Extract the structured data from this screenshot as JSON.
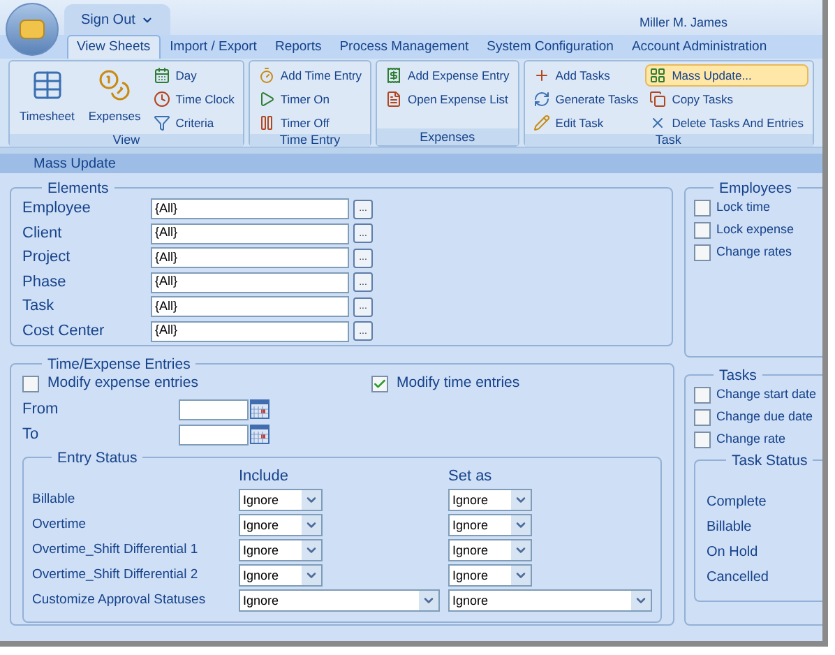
{
  "user_menu": {
    "label": "Sign Out"
  },
  "user_name": "Miller M. James",
  "tabs": [
    {
      "label": "View Sheets",
      "selected": true
    },
    {
      "label": "Import / Export",
      "selected": false
    },
    {
      "label": "Reports",
      "selected": false
    },
    {
      "label": "Process Management",
      "selected": false
    },
    {
      "label": "System Configuration",
      "selected": false
    },
    {
      "label": "Account Administration",
      "selected": false
    }
  ],
  "ribbon_groups": [
    {
      "label": "View",
      "items": [
        {
          "label": "Timesheet",
          "kind": "large",
          "selected": false
        },
        {
          "label": "Expenses",
          "kind": "large",
          "selected": false
        },
        {
          "label": "Day",
          "kind": "small",
          "selected": false
        },
        {
          "label": "Time Clock",
          "kind": "small",
          "selected": false
        },
        {
          "label": "Criteria",
          "kind": "small",
          "selected": false
        }
      ]
    },
    {
      "label": "Time Entry",
      "items": [
        {
          "label": "Add Time Entry",
          "kind": "small",
          "selected": false
        },
        {
          "label": "Timer On",
          "kind": "small",
          "selected": false
        },
        {
          "label": "Timer Off",
          "kind": "small",
          "selected": false
        }
      ]
    },
    {
      "label": "Expenses",
      "items": [
        {
          "label": "Add Expense Entry",
          "kind": "small",
          "selected": false
        },
        {
          "label": "Open Expense List",
          "kind": "small",
          "selected": false
        }
      ]
    },
    {
      "label": "Task",
      "items": [
        {
          "label": "Add Tasks",
          "kind": "small",
          "selected": false
        },
        {
          "label": "Generate Tasks",
          "kind": "small",
          "selected": false
        },
        {
          "label": "Edit Task",
          "kind": "small",
          "selected": false
        },
        {
          "label": "Mass Update...",
          "kind": "small",
          "selected": true
        },
        {
          "label": "Copy Tasks",
          "kind": "small",
          "selected": false
        },
        {
          "label": "Delete Tasks And Entries",
          "kind": "small",
          "selected": false
        }
      ]
    }
  ],
  "panel_title": "Mass Update",
  "elements": {
    "title": "Elements",
    "fields": [
      {
        "label": "Employee",
        "value": "{All}",
        "button": "..."
      },
      {
        "label": "Client",
        "value": "{All}",
        "button": "..."
      },
      {
        "label": "Project",
        "value": "{All}",
        "button": "..."
      },
      {
        "label": "Phase",
        "value": "{All}",
        "button": "..."
      },
      {
        "label": "Task",
        "value": "{All}",
        "button": "..."
      },
      {
        "label": "Cost Center",
        "value": "{All}",
        "button": "..."
      }
    ]
  },
  "employees": {
    "title": "Employees",
    "options": [
      {
        "label": "Lock time",
        "checked": false
      },
      {
        "label": "Lock expense",
        "checked": false
      },
      {
        "label": "Change rates",
        "checked": false
      }
    ]
  },
  "time_expense": {
    "title": "Time/Expense Entries",
    "options": [
      {
        "label": "Modify expense entries",
        "checked": false
      },
      {
        "label": "Modify time entries",
        "checked": true
      }
    ],
    "dates": [
      {
        "label": "From"
      },
      {
        "label": "To"
      }
    ],
    "entry_status": {
      "title": "Entry Status",
      "columns": [
        "Include",
        "Set as"
      ],
      "rows": [
        {
          "label": "Billable",
          "include": "Ignore",
          "set_as": "Ignore",
          "kind": "narrow"
        },
        {
          "label": "Overtime",
          "include": "Ignore",
          "set_as": "Ignore",
          "kind": "narrow"
        },
        {
          "label": "Overtime_Shift Differential 1",
          "include": "Ignore",
          "set_as": "Ignore",
          "kind": "narrow"
        },
        {
          "label": "Overtime_Shift Differential 2",
          "include": "Ignore",
          "set_as": "Ignore",
          "kind": "narrow"
        },
        {
          "label": "Customize Approval Statuses",
          "include": "Ignore",
          "set_as": "Ignore",
          "kind": "wide"
        }
      ]
    }
  },
  "tasks": {
    "title": "Tasks",
    "options": [
      {
        "label": "Change start date",
        "checked": false
      },
      {
        "label": "Change due date",
        "checked": false
      },
      {
        "label": "Change rate",
        "checked": false
      }
    ],
    "task_status": {
      "title": "Task Status",
      "items": [
        "Complete",
        "Billable",
        "On Hold",
        "Cancelled"
      ]
    }
  }
}
